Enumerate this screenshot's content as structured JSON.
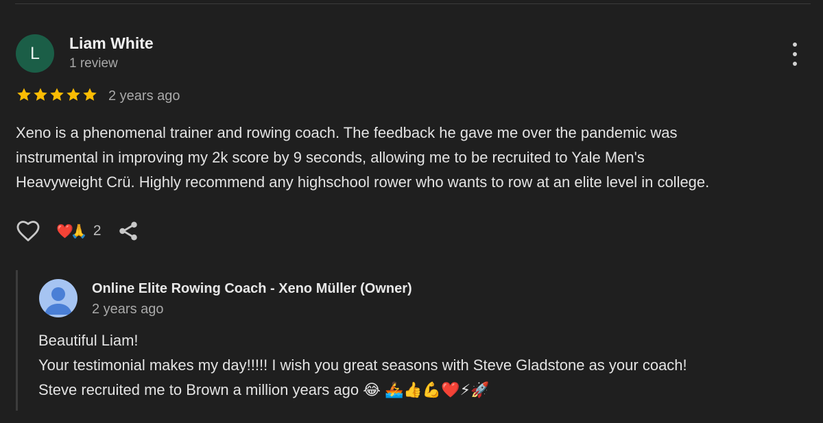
{
  "review": {
    "avatar_letter": "L",
    "avatar_color": "#1b5e47",
    "reviewer_name": "Liam White",
    "review_count": "1 review",
    "rating": 5,
    "rating_max": 5,
    "star_color": "#fbbc04",
    "date": "2 years ago",
    "text_lines": [
      "Xeno is a phenomenal trainer and rowing coach. The feedback he gave me over the pandemic was",
      "instrumental in improving my 2k score by 9 seconds, allowing me to be recruited to Yale Men's",
      "Heavyweight Crü. Highly recommend any highschool rower who wants to row at an elite level in college."
    ],
    "actions": {
      "like_icon": "heart-outline-icon",
      "reaction_emojis": "❤️🙏",
      "reaction_count": "2",
      "share_icon": "share-icon",
      "more_icon": "more-vert-icon"
    }
  },
  "reply": {
    "owner_avatar_icon": "person-icon",
    "owner_name": "Online Elite Rowing Coach - Xeno Müller (Owner)",
    "date": "2 years ago",
    "text_lines": [
      "Beautiful Liam!",
      "Your testimonial makes my day!!!!! I wish you great seasons with Steve Gladstone as your coach!",
      "Steve recruited me to Brown a million years ago 😂 🚣👍💪❤️⚡🚀"
    ]
  }
}
